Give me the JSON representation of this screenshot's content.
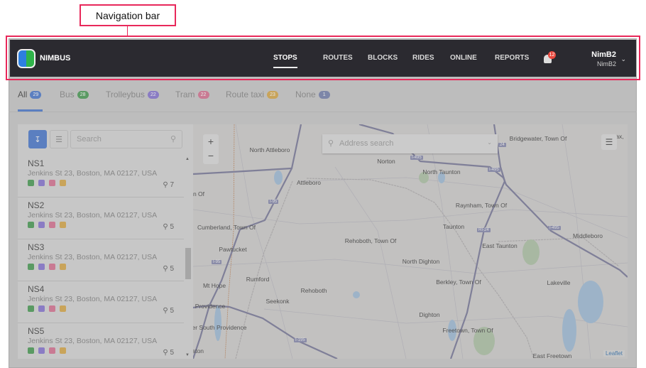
{
  "annotation": {
    "label": "Navigation bar"
  },
  "nav": {
    "brand": "NIMBUS",
    "items": [
      "STOPS",
      "ROUTES",
      "BLOCKS",
      "RIDES",
      "ONLINE",
      "REPORTS"
    ],
    "active": "STOPS",
    "notifications": "12",
    "user_name": "NimB2",
    "user_sub": "NimB2"
  },
  "tabs": [
    {
      "label": "All",
      "count": "29",
      "color": "#5b7fc0"
    },
    {
      "label": "Bus",
      "count": "28",
      "color": "#5a9a63"
    },
    {
      "label": "Trolleybus",
      "count": "22",
      "color": "#8a7cc4"
    },
    {
      "label": "Tram",
      "count": "22",
      "color": "#c97a93"
    },
    {
      "label": "Route taxi",
      "count": "23",
      "color": "#c9a45a"
    },
    {
      "label": "None",
      "count": "1",
      "color": "#7d86a8"
    }
  ],
  "panel": {
    "search_placeholder": "Search",
    "stops": [
      {
        "name": "NS1",
        "address": "Jenkins St 23, Boston, MA 02127, USA",
        "routes": "7"
      },
      {
        "name": "NS2",
        "address": "Jenkins St 23, Boston, MA 02127, USA",
        "routes": "5"
      },
      {
        "name": "NS3",
        "address": "Jenkins St 23, Boston, MA 02127, USA",
        "routes": "5"
      },
      {
        "name": "NS4",
        "address": "Jenkins St 23, Boston, MA 02127, USA",
        "routes": "5"
      },
      {
        "name": "NS5",
        "address": "Jenkins St 23, Boston, MA 02127, USA",
        "routes": "5"
      }
    ]
  },
  "map": {
    "address_placeholder": "Address search",
    "attribution": "Leaflet",
    "labels": [
      "North Attleboro",
      "Norton",
      "North Taunton",
      "Attleboro",
      "Bridgewater, Town Of",
      "Raynham, Town Of",
      "Taunton",
      "Cumberland, Town Of",
      "Rehoboth, Town Of",
      "Pawtucket",
      "East Taunton",
      "Middleboro",
      "North Dighton",
      "Rumford",
      "Mt Hope",
      "Rehoboth",
      "Berkley, Town Of",
      "Lakeville",
      "Seekonk",
      "Providence",
      "Dighton",
      "er South Providence",
      "Freetown, Town Of",
      "East Freetown",
      "ston",
      "n Of",
      "ax,"
    ],
    "shields": [
      "I-495",
      "I-495",
      "I-95",
      "I-95",
      "RI-24",
      "I-495",
      "I-195",
      "24"
    ]
  }
}
